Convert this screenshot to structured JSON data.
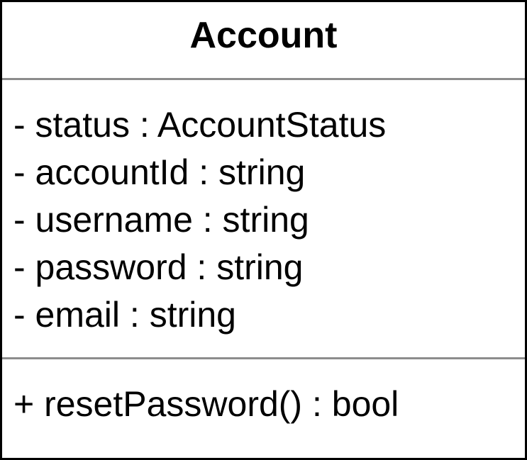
{
  "class_box": {
    "name": "Account",
    "attributes": [
      "- status : AccountStatus",
      "- accountId : string",
      "- username : string",
      "- password : string",
      "- email : string"
    ],
    "operations": [
      "+ resetPassword() : bool"
    ]
  },
  "colors": {
    "border": "#000000",
    "divider": "#8c8c8c",
    "background": "#ffffff",
    "text": "#000000"
  }
}
